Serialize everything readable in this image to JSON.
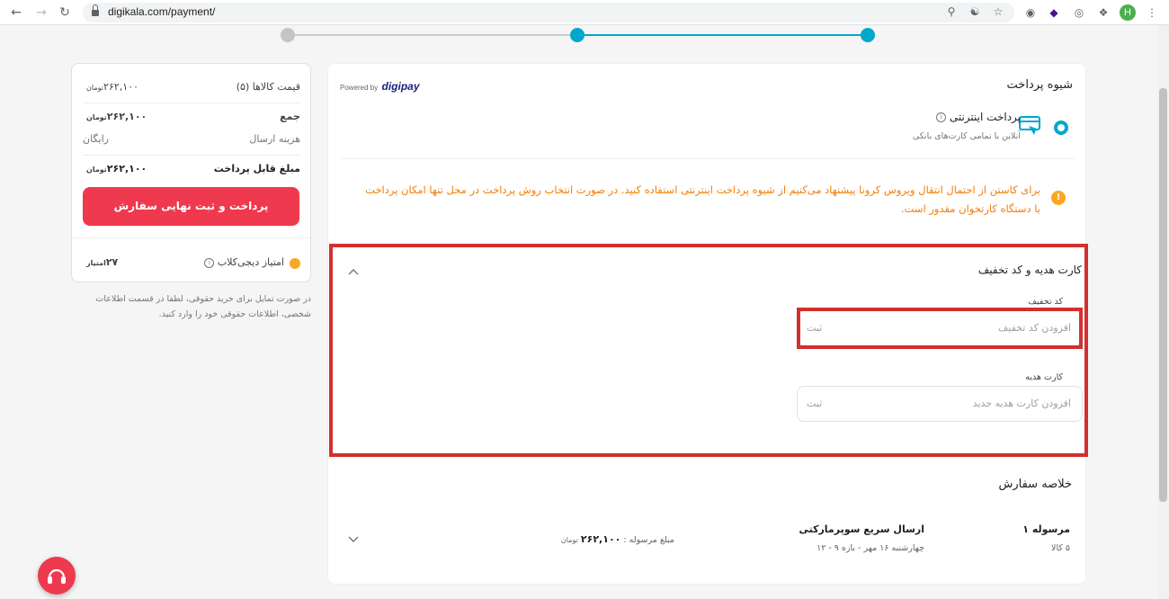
{
  "browser": {
    "url": "digikala.com/payment/",
    "profile_initial": "H"
  },
  "colors": {
    "accent": "#00a8cc",
    "brand_red": "#ef394e",
    "highlight": "#d32f2f",
    "warning": "#f57c00"
  },
  "summary": {
    "items_label": "قیمت کالاها (۵)",
    "items_value": "۲۶۲,۱۰۰",
    "sum_label": "جمع",
    "sum_value": "۲۶۲,۱۰۰",
    "shipping_label": "هزینه ارسال",
    "shipping_value": "رایگان",
    "payable_label": "مبلغ قابل پرداخت",
    "payable_value": "۲۶۲,۱۰۰",
    "currency": "تومان",
    "pay_button": "پرداخت و ثبت نهایی سفارش",
    "club_label": "امتیاز دیجی‌کلاب",
    "club_value": "۲۷",
    "club_unit": "امتیاز",
    "legal_note": "در صورت تمایل برای خرید حقوقی، لطفا در قسمت اطلاعات شخصی، اطلاعات حقوقی خود را وارد کنید."
  },
  "payment": {
    "title": "شیوه پرداخت",
    "powered_by": "Powered by",
    "provider": "digipay",
    "option_title": "پرداخت اینترنتی",
    "option_subtitle": "آنلاین با تمامی کارت‌های بانکی",
    "warning": "برای کاستن از احتمال انتقال ویروس کرونا پیشنهاد می‌کنیم از شیوه پرداخت اینترنتی استفاده کنید. در صورت انتخاب روش پرداخت در محل تنها امکان پرداخت با دستگاه کارتخوان مقدور است."
  },
  "gift": {
    "title": "کارت هدیه و کد تخفیف",
    "discount_label": "کد تخفیف",
    "discount_placeholder": "افزودن کد تخفیف",
    "discount_submit": "ثبت",
    "giftcard_label": "کارت هدیه",
    "giftcard_placeholder": "افزودن کارت هدیه جدید",
    "giftcard_submit": "ثبت"
  },
  "order": {
    "title": "خلاصه سفارش",
    "shipment_name": "مرسوله ۱",
    "shipment_count": "۵ کالا",
    "shipping_method": "ارسال سریع سوپرمارکتی",
    "shipping_time": "چهارشنبه ۱۶ مهر - بازه ۹ - ۱۲",
    "shipment_price_label": "مبلغ مرسوله :",
    "shipment_price": "۲۶۲,۱۰۰",
    "currency": "تومان"
  }
}
